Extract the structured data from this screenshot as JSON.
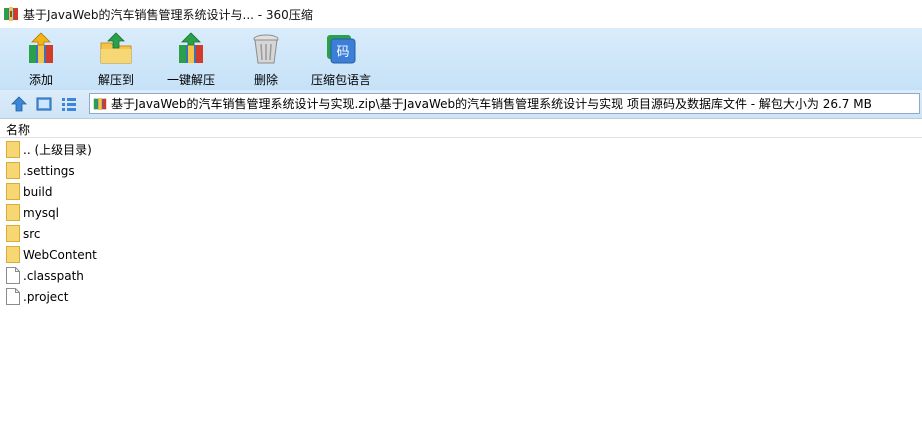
{
  "window": {
    "title": "基于JavaWeb的汽车销售管理系统设计与... - 360压缩"
  },
  "toolbar": {
    "add": "添加",
    "extract_to": "解压到",
    "one_click_extract": "一键解压",
    "delete": "删除",
    "archive_language": "压缩包语言"
  },
  "address": {
    "path": "基于JavaWeb的汽车销售管理系统设计与实现.zip\\基于JavaWeb的汽车销售管理系统设计与实现 项目源码及数据库文件 - 解包大小为 26.7 MB"
  },
  "list": {
    "column_name": "名称",
    "items": [
      {
        "name": ".. (上级目录)",
        "type": "folder"
      },
      {
        "name": ".settings",
        "type": "folder"
      },
      {
        "name": "build",
        "type": "folder"
      },
      {
        "name": "mysql",
        "type": "folder"
      },
      {
        "name": "src",
        "type": "folder"
      },
      {
        "name": "WebContent",
        "type": "folder"
      },
      {
        "name": ".classpath",
        "type": "file"
      },
      {
        "name": ".project",
        "type": "file"
      }
    ]
  },
  "colors": {
    "toolbar_bg": "#c6e1f7",
    "folder": "#f7d774",
    "path_border": "#8eaacb"
  }
}
